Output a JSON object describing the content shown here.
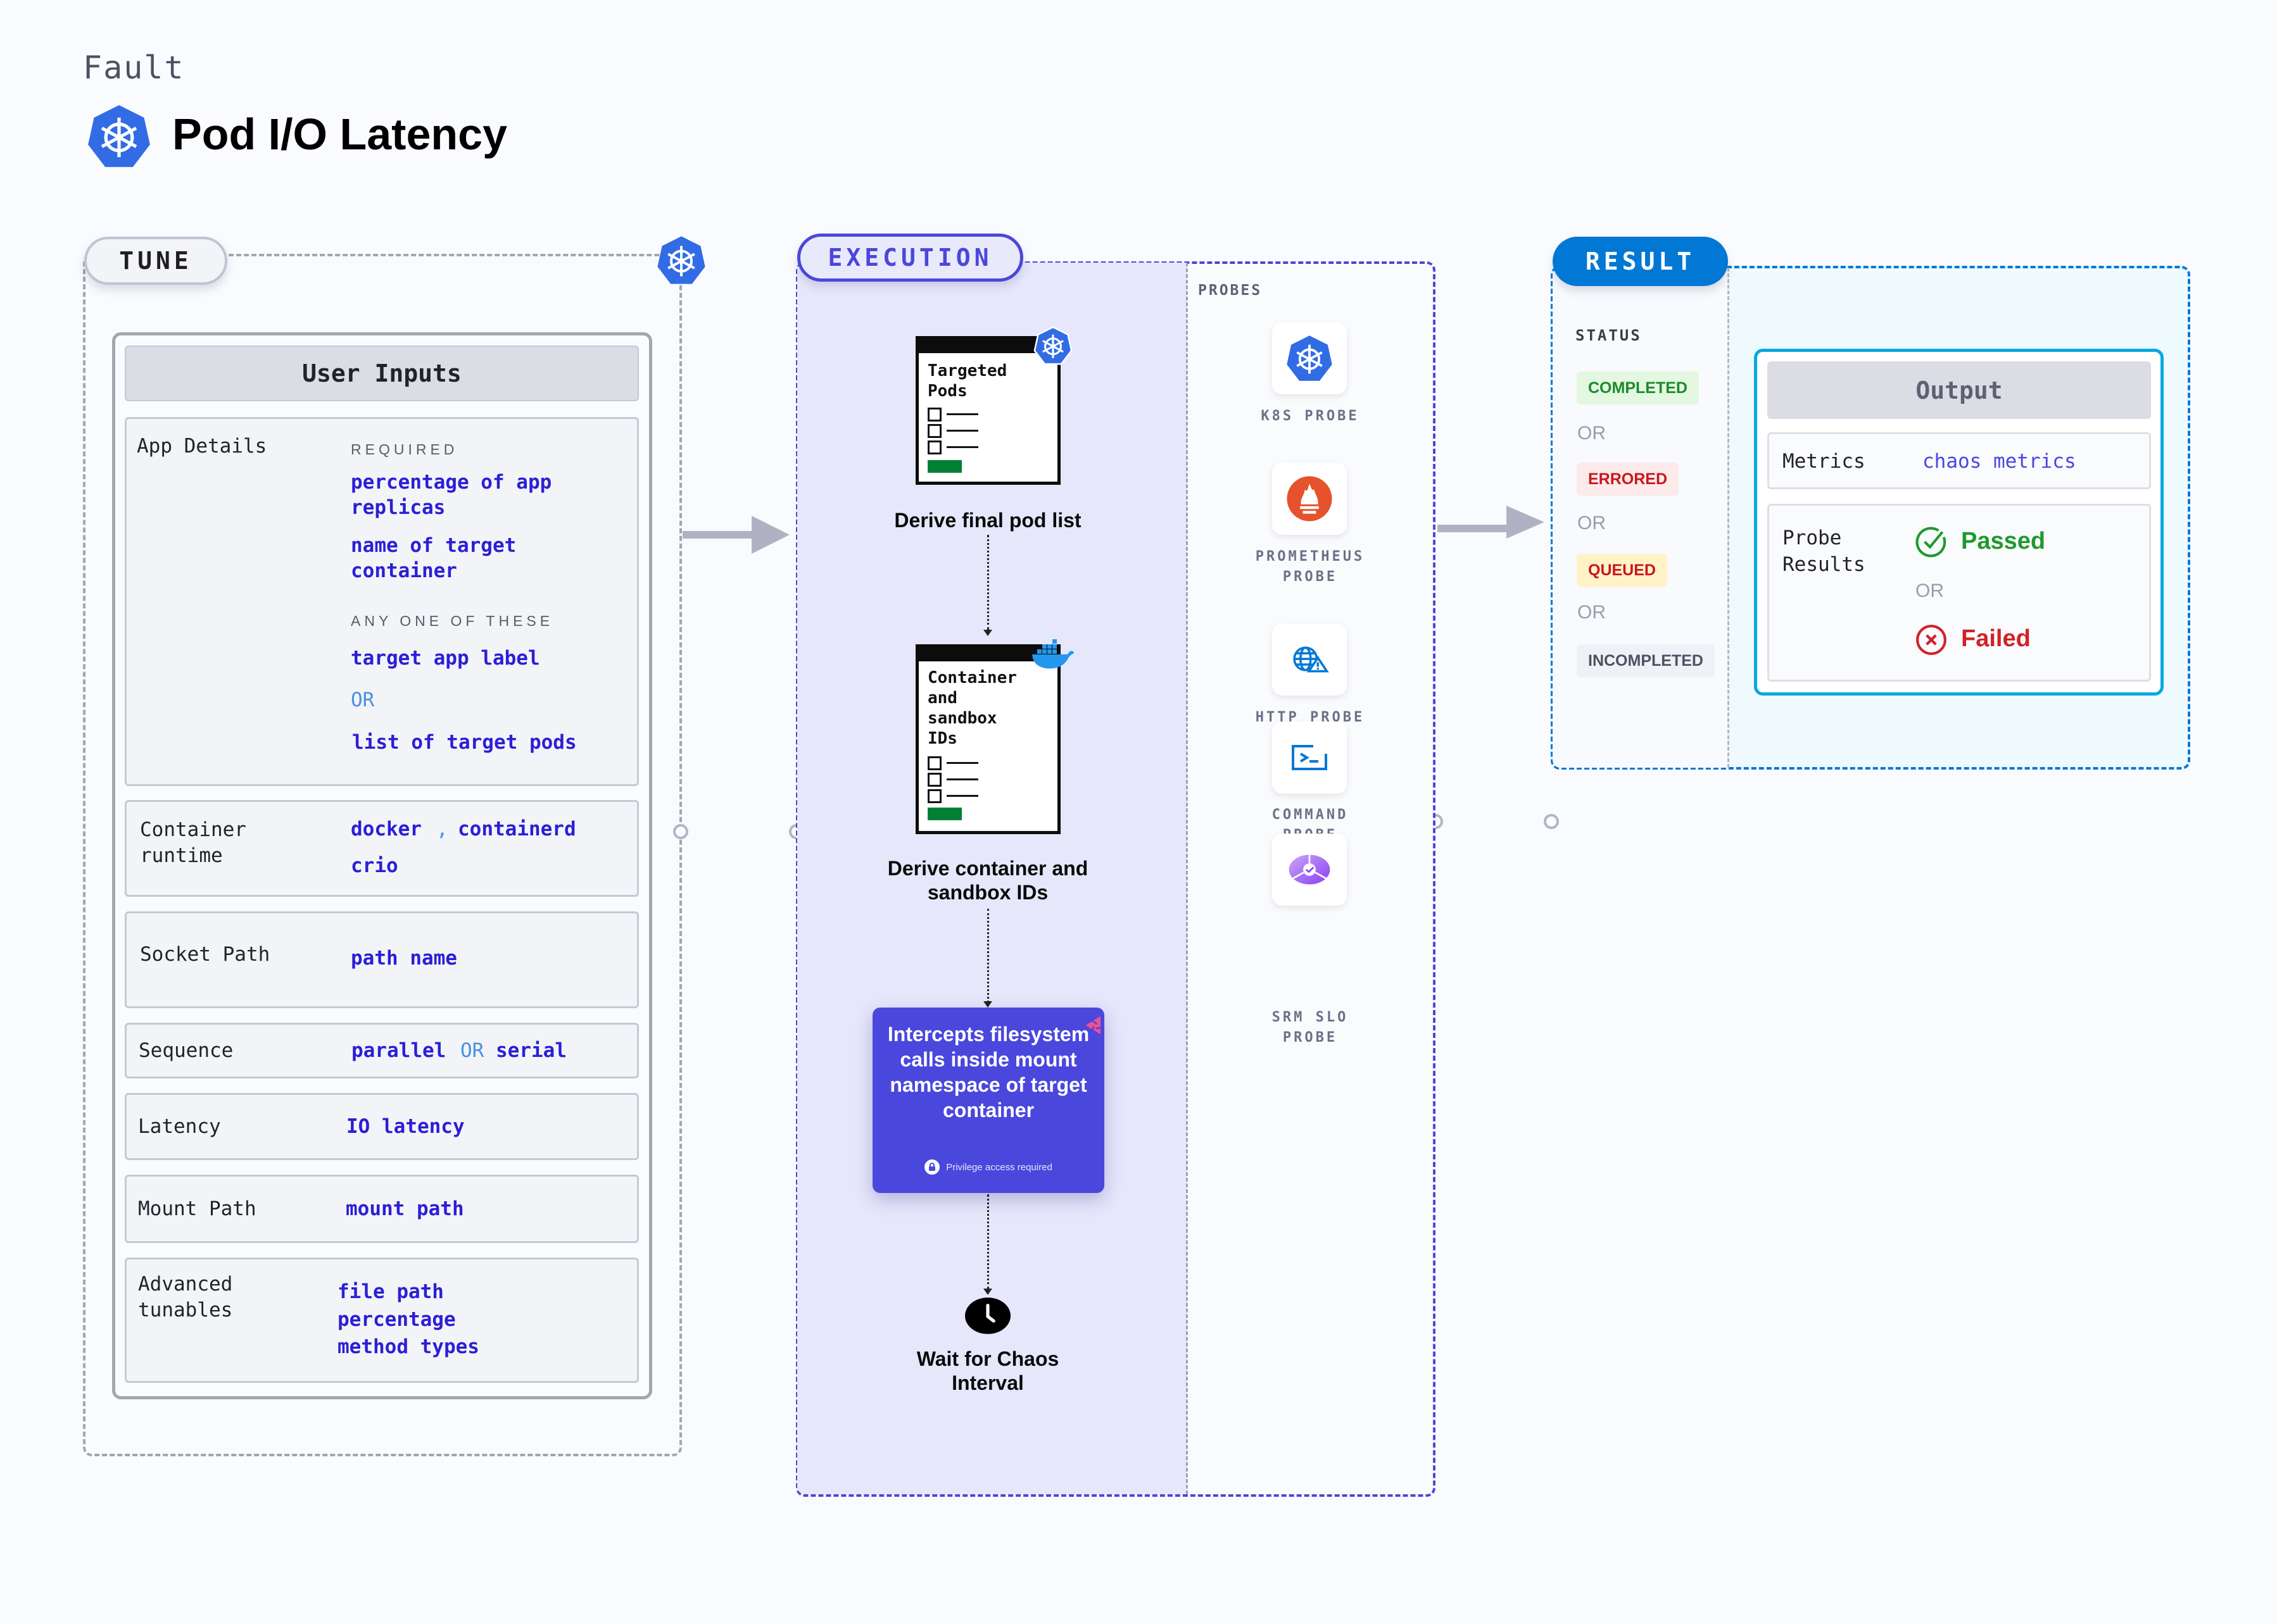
{
  "header": {
    "kicker": "Fault",
    "title": "Pod I/O Latency",
    "icon": "kubernetes-icon"
  },
  "tune": {
    "pill_label": "TUNE",
    "corner_icon": "kubernetes-icon",
    "panel_title": "User Inputs",
    "rows": [
      {
        "label": "App Details",
        "required_caption": "REQUIRED",
        "required": [
          "percentage of app replicas",
          "name of target container"
        ],
        "any_caption": "ANY ONE OF THESE",
        "any": [
          "target app label",
          "OR",
          "list of target pods"
        ]
      },
      {
        "label": "Container runtime",
        "values": [
          "docker",
          ",",
          "containerd",
          "crio"
        ]
      },
      {
        "label": "Socket Path",
        "values": [
          "path name"
        ]
      },
      {
        "label": "Sequence",
        "values": [
          "parallel",
          "OR",
          "serial"
        ]
      },
      {
        "label": "Latency",
        "values": [
          "IO latency"
        ]
      },
      {
        "label": "Mount Path",
        "values": [
          "mount path"
        ]
      },
      {
        "label": "Advanced tunables",
        "values": [
          "file path",
          "percentage",
          "method types"
        ]
      }
    ]
  },
  "execution": {
    "pill_label": "EXECUTION",
    "steps": [
      {
        "card_title": "Targeted Pods",
        "badge_icon": "kubernetes-icon",
        "label": "Derive final pod list"
      },
      {
        "card_title": "Container and sandbox IDs",
        "badge_icon": "docker-icon",
        "label": "Derive container and sandbox IDs"
      },
      {
        "card_text": "Intercepts filesystem calls inside mount namespace of target container",
        "note": "Privilege access required",
        "badge_icon": "chaos-icon"
      },
      {
        "label": "Wait for Chaos Interval",
        "icon": "clock-icon"
      }
    ],
    "probes_title": "PROBES",
    "probes": [
      {
        "label": "K8S PROBE",
        "icon": "kubernetes-icon"
      },
      {
        "label": "PROMETHEUS PROBE",
        "icon": "prometheus-icon"
      },
      {
        "label": "HTTP PROBE",
        "icon": "http-globe-icon"
      },
      {
        "label": "COMMAND PROBE",
        "icon": "terminal-icon"
      },
      {
        "label": "SRM SLO PROBE",
        "icon": "slo-icon"
      }
    ]
  },
  "result": {
    "pill_label": "RESULT",
    "status_title": "STATUS",
    "or_label": "OR",
    "statuses": [
      {
        "label": "COMPLETED",
        "color": "#1b8a2a",
        "bg": "#e4f7e1"
      },
      {
        "label": "ERRORED",
        "color": "#c8161d",
        "bg": "#fcebea"
      },
      {
        "label": "QUEUED",
        "color": "#c8161d",
        "bg": "#fff2c7"
      },
      {
        "label": "INCOMPLETED",
        "color": "#4f5162",
        "bg": "#f0f1f6"
      }
    ],
    "output": {
      "title": "Output",
      "metrics_label": "Metrics",
      "metrics_value": "chaos metrics",
      "probe_results_label": "Probe Results",
      "passed": "Passed",
      "or_label": "OR",
      "failed": "Failed"
    }
  },
  "colors": {
    "execution_accent": "#4b47d9",
    "result_accent": "#0278d5",
    "value_text": "#2b1fd6",
    "passed": "#1f9a2e",
    "failed": "#d12226"
  }
}
